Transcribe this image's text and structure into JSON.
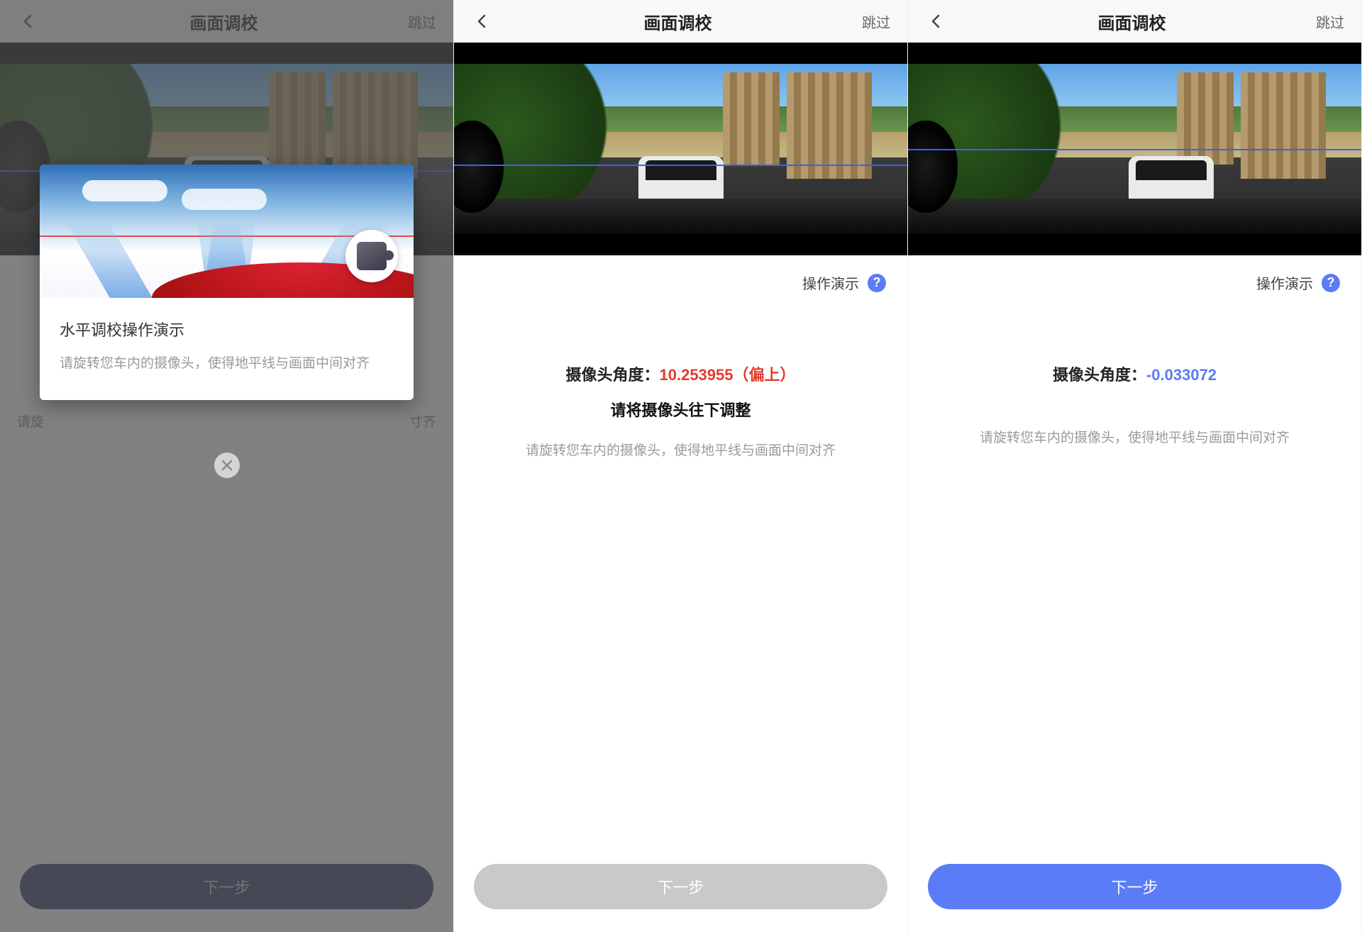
{
  "common": {
    "header_title": "画面调校",
    "skip": "跳过",
    "demo_label": "操作演示",
    "instruction": "请旋转您车内的摄像头，使得地平线与画面中间对齐",
    "next": "下一步",
    "angle_label": "摄像头角度："
  },
  "screen1": {
    "modal_title": "水平调校操作演示",
    "modal_desc": "请旋转您车内的摄像头，使得地平线与画面中间对齐",
    "peek_left": "请旋",
    "peek_right": "寸齐"
  },
  "screen2": {
    "angle_value": "10.253955（偏上）",
    "adjust_hint": "请将摄像头往下调整"
  },
  "screen3": {
    "angle_value": "-0.033072"
  }
}
